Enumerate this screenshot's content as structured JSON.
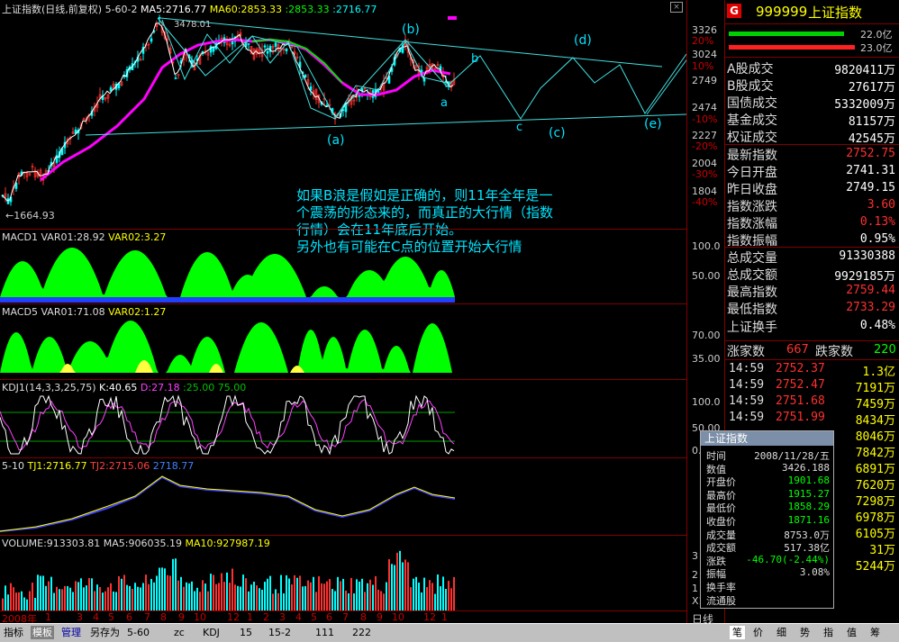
{
  "main_chart": {
    "header_title": "上证指数(日线,前复权)",
    "header_period": "5-60-2",
    "ma5_label": "MA5:2716.77",
    "ma60_label": "MA60:2853.33",
    "extra_a": ":2853.33",
    "extra_b": ":2716.77",
    "high_label": "3478.01",
    "low_label": "←1664.93",
    "wave_labels": {
      "b_top": "(b)",
      "b_small": "b",
      "a_small": "a",
      "a_paren": "(a)",
      "c_small": "c",
      "c_paren": "(c)",
      "d_paren": "(d)",
      "e_paren": "(e)"
    },
    "y_ticks": [
      "3326",
      "20%",
      "3024",
      "10%",
      "2749",
      "2474",
      "-10%",
      "2227",
      "-20%",
      "2004",
      "-30%",
      "1804",
      "-40%"
    ],
    "annotation": [
      "如果B浪是假如是正确的，则11年全年是一",
      "个震荡的形态来的，而真正的大行情（指数",
      "行情）会在11年底后开始。",
      "另外也有可能在C点的位置开始大行情"
    ]
  },
  "macd1": {
    "title": "MACD1",
    "var01": "VAR01:28.92",
    "var02": "VAR02:3.27",
    "ticks": [
      "100.0",
      "50.00"
    ]
  },
  "macd5": {
    "title": "MACD5",
    "var01": "VAR01:71.08",
    "var02": "VAR02:1.27",
    "ticks": [
      "70.00",
      "35.00"
    ]
  },
  "kdj": {
    "title": "KDJ1(14,3,3,25,75)",
    "k": "K:40.65",
    "d": "D:27.18",
    "l25": ":25.00",
    "l75": "75.00",
    "ticks": [
      "100.0",
      "50.00",
      "0.00"
    ]
  },
  "tj": {
    "title": "5-10",
    "tj1": "TJ1:2716.77",
    "tj2": "TJ2:2715.06",
    "extra": "2718.77"
  },
  "volume": {
    "title": "VOLUME:913303.81",
    "ma5": "MA5:906035.19",
    "ma10": "MA10:927987.19",
    "ticks": [
      "3",
      "2",
      "1",
      "X1"
    ]
  },
  "x_axis": [
    "2008年",
    "1",
    "3",
    "4",
    "5",
    "6",
    "7",
    "8",
    "9",
    "10",
    "12",
    "1",
    "2",
    "3",
    "4",
    "5",
    "6",
    "7",
    "8",
    "9",
    "10",
    "12",
    "1"
  ],
  "right_panel": {
    "code": "999999",
    "name": "上证指数",
    "bar1_pct": "22.0亿",
    "bar2_pct": "23.0亿",
    "rows": [
      {
        "label": "A股成交",
        "value": "9820411万"
      },
      {
        "label": "B股成交",
        "value": "27617万"
      },
      {
        "label": "国债成交",
        "value": "5332009万"
      },
      {
        "label": "基金成交",
        "value": "81157万"
      },
      {
        "label": "权证成交",
        "value": "42545万"
      },
      {
        "label": "最新指数",
        "value": "2752.75"
      },
      {
        "label": "今日开盘",
        "value": "2741.31"
      },
      {
        "label": "昨日收盘",
        "value": "2749.15"
      },
      {
        "label": "指数涨跌",
        "value": "3.60"
      },
      {
        "label": "指数涨幅",
        "value": "0.13%"
      },
      {
        "label": "指数振幅",
        "value": "0.95%"
      },
      {
        "label": "总成交量",
        "value": "91330388"
      },
      {
        "label": "总成交额",
        "value": "9929185万"
      },
      {
        "label": "最高指数",
        "value": "2759.44"
      },
      {
        "label": "最低指数",
        "value": "2733.29"
      },
      {
        "label": "上证换手",
        "value": "0.48%"
      }
    ],
    "adv_label": "涨家数",
    "adv_value": "667",
    "dec_label": "跌家数",
    "dec_value": "220",
    "ticks": [
      {
        "time": "14:59",
        "price": "2752.37",
        "vol": "1.3亿"
      },
      {
        "time": "14:59",
        "price": "2752.47",
        "vol": "7191万"
      },
      {
        "time": "14:59",
        "price": "2751.68",
        "vol": "7459万"
      },
      {
        "time": "14:59",
        "price": "2751.99",
        "vol": "8434万"
      },
      {
        "time": "",
        "price": "",
        "vol": "8046万"
      },
      {
        "time": "",
        "price": "",
        "vol": "7842万"
      },
      {
        "time": "",
        "price": "",
        "vol": "6891万"
      },
      {
        "time": "",
        "price": "",
        "vol": "7620万"
      },
      {
        "time": "",
        "price": "",
        "vol": "7298万"
      },
      {
        "time": "",
        "price": "",
        "vol": "6978万"
      },
      {
        "time": "",
        "price": "",
        "vol": "6105万"
      },
      {
        "time": "",
        "price": "",
        "vol": "31万"
      },
      {
        "time": "",
        "price": "",
        "vol": "5244万"
      }
    ],
    "tabs": [
      "笔",
      "价",
      "细",
      "势",
      "指",
      "值",
      "筹"
    ]
  },
  "popup": {
    "title": "上证指数",
    "rows": [
      {
        "k": "时间",
        "v": "2008/11/28/五"
      },
      {
        "k": "数值",
        "v": "3426.188"
      },
      {
        "k": "开盘价",
        "v": "1901.68"
      },
      {
        "k": "最高价",
        "v": "1915.27"
      },
      {
        "k": "最低价",
        "v": "1858.29"
      },
      {
        "k": "收盘价",
        "v": "1871.16"
      },
      {
        "k": "成交量",
        "v": "8753.0万"
      },
      {
        "k": "成交额",
        "v": "517.38亿"
      },
      {
        "k": "涨跌",
        "v": "-46.70(-2.44%)"
      },
      {
        "k": "振幅",
        "v": "3.08%"
      },
      {
        "k": "换手率",
        "v": ""
      },
      {
        "k": "流通股",
        "v": ""
      }
    ]
  },
  "bottom_bar": {
    "buttons": [
      "指标",
      "模板",
      "管理",
      "另存为",
      "5-60",
      "zc",
      "KDJ",
      "15",
      "15-2",
      "111",
      "222"
    ],
    "daily": "日线"
  },
  "colors": {
    "up": "#ff3030",
    "down": "#00ffff",
    "ma5": "#ffffff",
    "ma60": "#ff00ff",
    "macd_fill": "#00ff00",
    "accent": "#00e5ff"
  }
}
